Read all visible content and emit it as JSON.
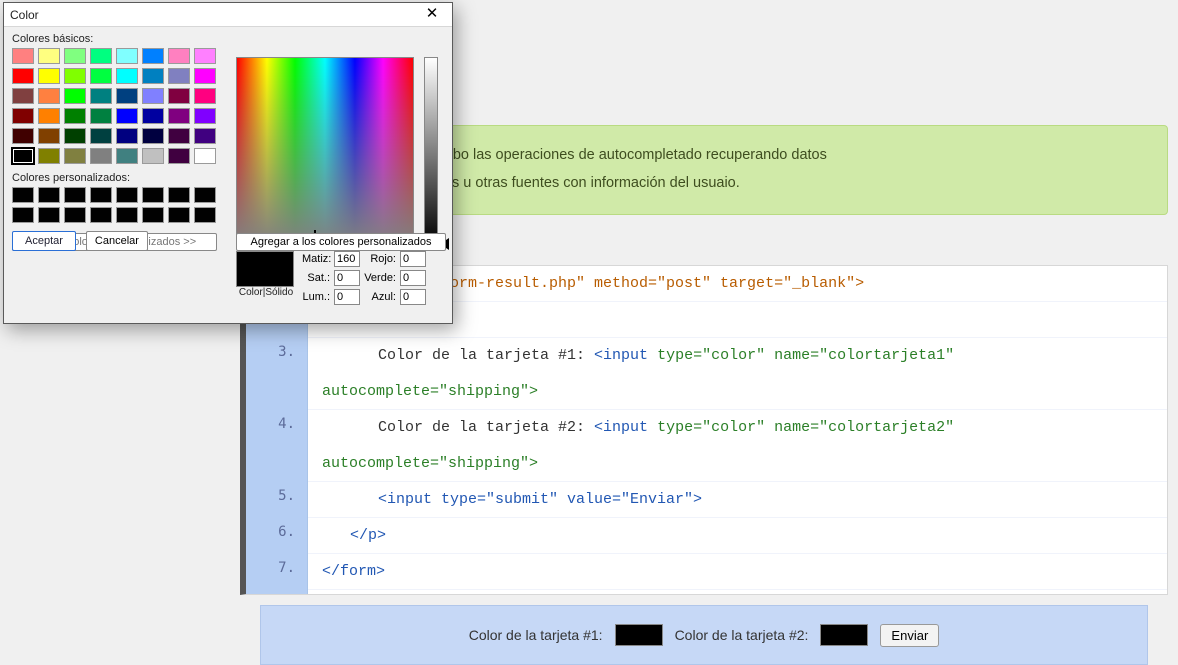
{
  "note": {
    "line1": ", los navegadores llevan a cabo las operaciones de autocompletado recuperando datos",
    "line2": " de datos con entradas previas u otras fuentes con información del usuaio."
  },
  "code": {
    "gutter": [
      "3.",
      "4.",
      "5.",
      "6.",
      "7."
    ],
    "row0_tail": "\"../../form-result.php\" method=\"post\" target=\"_blank\">",
    "row3_txt": "Color de la tarjeta #1: ",
    "row3_tag": "<input ",
    "row3_attrs": "type=\"color\" name=\"colortarjeta1\"",
    "row3_wrap": "autocomplete=\"shipping\">",
    "row4_txt": "Color de la tarjeta #2: ",
    "row4_tag": "<input ",
    "row4_attrs": "type=\"color\" name=\"colortarjeta2\"",
    "row4_wrap": "autocomplete=\"shipping\">",
    "row5": "<input type=\"submit\" value=\"Enviar\">",
    "row6": "</p>",
    "row7": "</form>"
  },
  "preview": {
    "label1": "Color de la tarjeta #1:",
    "label2": "Color de la tarjeta #2:",
    "submit": "Enviar"
  },
  "dialog": {
    "title": "Color",
    "basic_label": "Colores básicos:",
    "custom_label": "Colores personalizados:",
    "define_btn": "Definir colores personalizados >>",
    "ok": "Aceptar",
    "cancel": "Cancelar",
    "add_btn": "Agregar a los colores personalizados",
    "color_solid": "Color|Sólido",
    "labels": {
      "matiz": "Matiz:",
      "sat": "Sat.:",
      "lum": "Lum.:",
      "rojo": "Rojo:",
      "verde": "Verde:",
      "azul": "Azul:"
    },
    "values": {
      "matiz": "160",
      "sat": "0",
      "lum": "0",
      "rojo": "0",
      "verde": "0",
      "azul": "0"
    },
    "basic_colors": [
      "#ff8080",
      "#ffff80",
      "#80ff80",
      "#00ff80",
      "#80ffff",
      "#0080ff",
      "#ff80c0",
      "#ff80ff",
      "#ff0000",
      "#ffff00",
      "#80ff00",
      "#00ff40",
      "#00ffff",
      "#0080c0",
      "#8080c0",
      "#ff00ff",
      "#804040",
      "#ff8040",
      "#00ff00",
      "#008080",
      "#004080",
      "#8080ff",
      "#800040",
      "#ff0080",
      "#800000",
      "#ff8000",
      "#008000",
      "#008040",
      "#0000ff",
      "#0000a0",
      "#800080",
      "#8000ff",
      "#400000",
      "#804000",
      "#004000",
      "#004040",
      "#000080",
      "#000040",
      "#400040",
      "#400080",
      "#000000",
      "#808000",
      "#808040",
      "#808080",
      "#408080",
      "#c0c0c0",
      "#400040",
      "#ffffff"
    ],
    "selected_index": 40
  }
}
